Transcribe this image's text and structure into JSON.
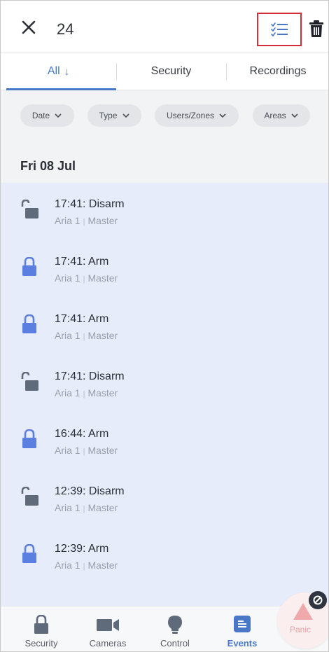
{
  "header": {
    "count": "24"
  },
  "tabs": [
    {
      "label": "All",
      "arrow": "↓",
      "active": true
    },
    {
      "label": "Security",
      "active": false
    },
    {
      "label": "Recordings",
      "active": false
    }
  ],
  "filters": [
    "Date",
    "Type",
    "Users/Zones",
    "Areas"
  ],
  "date_group": "Fri 08 Jul",
  "events": [
    {
      "title": "17:41: Disarm",
      "area": "Aria 1",
      "user": "Master",
      "state": "unlocked"
    },
    {
      "title": "17:41: Arm",
      "area": "Aria 1",
      "user": "Master",
      "state": "locked"
    },
    {
      "title": "17:41: Arm",
      "area": "Aria 1",
      "user": "Master",
      "state": "locked"
    },
    {
      "title": "17:41: Disarm",
      "area": "Aria 1",
      "user": "Master",
      "state": "unlocked"
    },
    {
      "title": "16:44: Arm",
      "area": "Aria 1",
      "user": "Master",
      "state": "locked"
    },
    {
      "title": "12:39: Disarm",
      "area": "Aria 1",
      "user": "Master",
      "state": "unlocked"
    },
    {
      "title": "12:39: Arm",
      "area": "Aria 1",
      "user": "Master",
      "state": "locked"
    }
  ],
  "nav": [
    {
      "label": "Security",
      "icon": "lock-icon"
    },
    {
      "label": "Cameras",
      "icon": "camera-icon"
    },
    {
      "label": "Control",
      "icon": "bulb-icon"
    },
    {
      "label": "Events",
      "icon": "events-icon",
      "active": true
    }
  ],
  "panic": {
    "label": "Panic"
  },
  "colors": {
    "accent": "#4a78c9",
    "locked": "#5b7fe0",
    "unlocked": "#5f6b7a",
    "list_bg": "#e7ecfb",
    "highlight_box": "#d32f3a"
  }
}
